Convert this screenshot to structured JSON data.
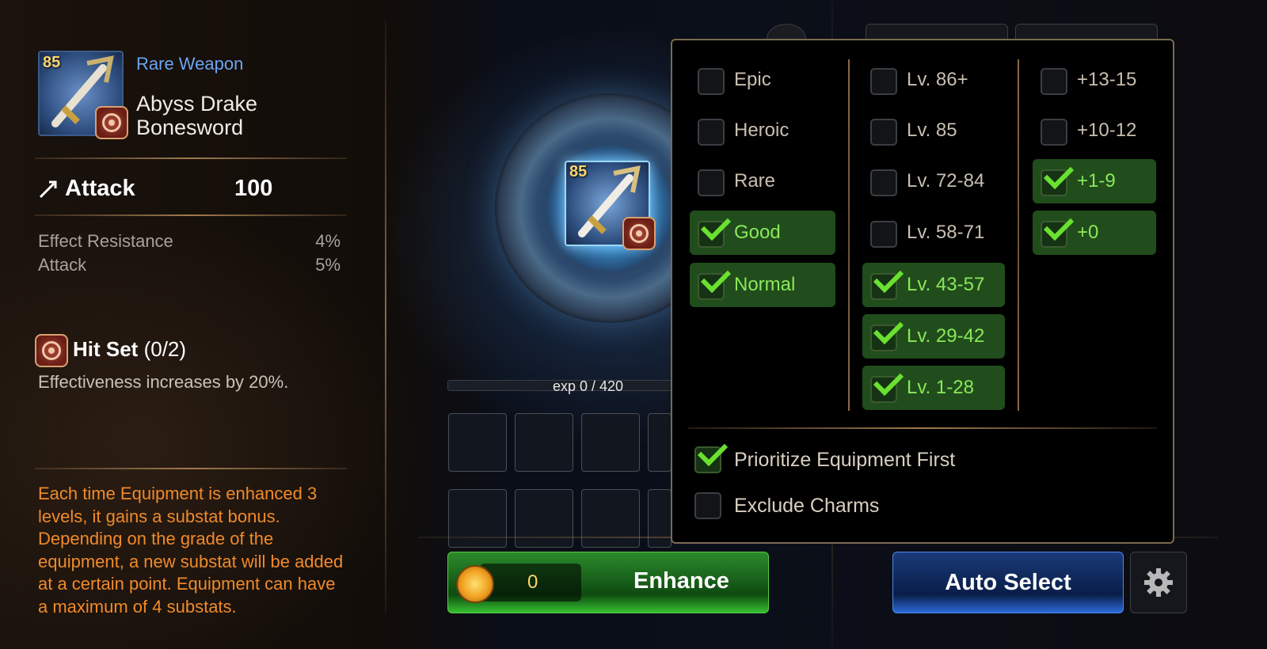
{
  "item": {
    "level": "85",
    "rarity": "Rare Weapon",
    "name_line1": "Abyss Drake",
    "name_line2": "Bonesword",
    "main_stat": {
      "label": "Attack",
      "value": "100"
    },
    "substats": [
      {
        "label": "Effect Resistance",
        "value": "4%"
      },
      {
        "label": "Attack",
        "value": "5%"
      }
    ],
    "set": {
      "name": "Hit Set",
      "count": "(0/2)",
      "description": "Effectiveness increases by 20%."
    },
    "info": "Each time Equipment is enhanced 3 levels, it gains a substat bonus. Depending on the grade of the equipment, a new substat will be added at a certain point. Equipment can have a maximum of 4 substats."
  },
  "center": {
    "item_level": "85",
    "exp_text": "exp 0 / 420",
    "enhance": {
      "cost": "0",
      "label": "Enhance"
    }
  },
  "right": {
    "auto_select_label": "Auto Select"
  },
  "filter": {
    "grades": [
      {
        "label": "Epic",
        "checked": false
      },
      {
        "label": "Heroic",
        "checked": false
      },
      {
        "label": "Rare",
        "checked": false
      },
      {
        "label": "Good",
        "checked": true
      },
      {
        "label": "Normal",
        "checked": true
      }
    ],
    "levels": [
      {
        "label": "Lv. 86+",
        "checked": false
      },
      {
        "label": "Lv. 85",
        "checked": false
      },
      {
        "label": "Lv. 72-84",
        "checked": false
      },
      {
        "label": "Lv. 58-71",
        "checked": false
      },
      {
        "label": "Lv. 43-57",
        "checked": true
      },
      {
        "label": "Lv. 29-42",
        "checked": true
      },
      {
        "label": "Lv. 1-28",
        "checked": true
      }
    ],
    "enhancements": [
      {
        "label": "+13-15",
        "checked": false
      },
      {
        "label": "+10-12",
        "checked": false
      },
      {
        "label": "+1-9",
        "checked": true
      },
      {
        "label": "+0",
        "checked": true
      }
    ],
    "options": [
      {
        "label": "Prioritize Equipment First",
        "checked": true
      },
      {
        "label": "Exclude Charms",
        "checked": false
      }
    ]
  },
  "colors": {
    "checked_bg": "#214d1c",
    "check_mark": "#6ae030",
    "rarity_blue": "#6aa4f0",
    "info_orange": "#f08a2a"
  }
}
